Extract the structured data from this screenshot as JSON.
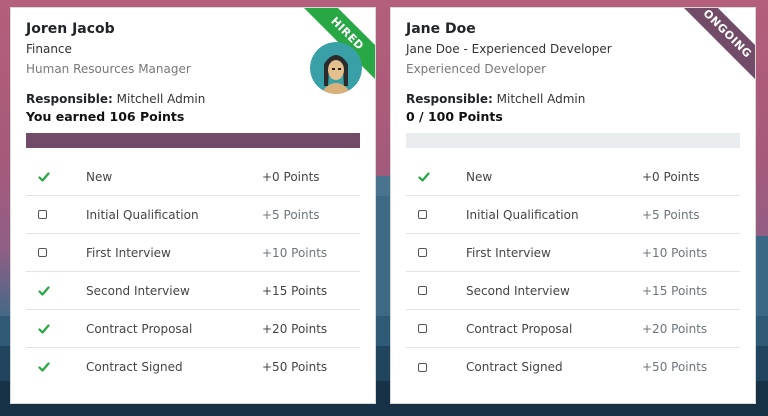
{
  "colors": {
    "progress_fill": "#714b67",
    "progress_track": "#e9ecef",
    "check": "#28a745",
    "ribbon_hired": "#28a745",
    "ribbon_ongoing": "#714b67"
  },
  "cards": [
    {
      "name": "Joren Jacob",
      "line2": "Finance",
      "line3": "Human Resources Manager",
      "responsible_label": "Responsible:",
      "responsible_value": "Mitchell Admin",
      "points_text": "You earned 106 Points",
      "progress_fraction": 1.0,
      "ribbon": "HIRED",
      "has_avatar": true,
      "stages": [
        {
          "label": "New",
          "points": "+0 Points",
          "done": true
        },
        {
          "label": "Initial Qualification",
          "points": "+5 Points",
          "done": false
        },
        {
          "label": "First Interview",
          "points": "+10 Points",
          "done": false
        },
        {
          "label": "Second Interview",
          "points": "+15 Points",
          "done": true
        },
        {
          "label": "Contract Proposal",
          "points": "+20 Points",
          "done": true
        },
        {
          "label": "Contract Signed",
          "points": "+50 Points",
          "done": true
        }
      ]
    },
    {
      "name": "Jane Doe",
      "line2": "Jane Doe - Experienced Developer",
      "line3": "Experienced Developer",
      "responsible_label": "Responsible:",
      "responsible_value": "Mitchell Admin",
      "points_text": "0 / 100 Points",
      "progress_fraction": 0.0,
      "ribbon": "ONGOING",
      "has_avatar": false,
      "stages": [
        {
          "label": "New",
          "points": "+0 Points",
          "done": true
        },
        {
          "label": "Initial Qualification",
          "points": "+5 Points",
          "done": false
        },
        {
          "label": "First Interview",
          "points": "+10 Points",
          "done": false
        },
        {
          "label": "Second Interview",
          "points": "+15 Points",
          "done": false
        },
        {
          "label": "Contract Proposal",
          "points": "+20 Points",
          "done": false
        },
        {
          "label": "Contract Signed",
          "points": "+50 Points",
          "done": false
        }
      ]
    }
  ]
}
